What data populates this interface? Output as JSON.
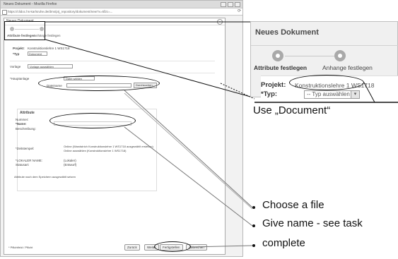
{
  "browser": {
    "title": "Neues Dokument - Mozilla Firefox",
    "url": "https://clidoc.hs-karlsruhe.de/dms/prj_repository/dokument/new?x=6f2c=..."
  },
  "dialog": {
    "header": "Neues Dokument",
    "close_glyph": "×",
    "steps": [
      "Attribute festlegen",
      "Anhänge festlegen"
    ],
    "projekt_label": "Projekt:",
    "projekt_value": "Konstruktionslehre 1 WS1718",
    "typ_label": "*Typ",
    "typ_value": "Dokument",
    "vorlage_label": "Vorlage",
    "vorlage_value": "Vorlage auswählen",
    "hauptanlage_label": "*Hauptanlage",
    "hauptanlage_value": "Datei wählen",
    "dateiname_label": "Dateiname",
    "durchsuchen_label": "Durchsuchen...",
    "section_title": "Attribute",
    "nummer_label": "Nummer:",
    "name_label": "*Name:",
    "beschreibung_label": "Beschreibung:",
    "zeitstempel_label": "*Zeitstempel:",
    "zeit_opt1": "Online (Wandstrich Konstruktionslehre 1 WS1718 ausgewählt erstellen)",
    "zeit_opt2": "Online auswählen (Konstruktionslehre 1 WS1718)",
    "lokal_label": "*LOKALER NAME:",
    "lokal_value": "(Lokaler)",
    "status_label": "Statusart:",
    "status_value": "(Entwurf)",
    "checkbox_label": "Attribute nach dem Speichern ausgewählt setzen",
    "footer_left": "* Pflichtfeld / Pflicht",
    "btn_back": "Zurück",
    "btn_next": "Weiter",
    "btn_finish": "Fertigstellen",
    "btn_cancel": "Abbrechen"
  },
  "zoom": {
    "title": "Neues Dokument",
    "step1": "Attribute festlegen",
    "step2": "Anhange festlegen",
    "projekt_label": "Projekt:",
    "projekt_value": "Konstruktionslehre 1 WS1718",
    "typ_label": "*Typ:",
    "typ_value": "-- Typ auswählen --",
    "arrow_glyph": "▾"
  },
  "callouts": {
    "use_document": "Use „Document“",
    "choose_file": "Choose a file",
    "give_name": "Give name - see task",
    "complete": "complete"
  },
  "colors": {
    "annotation": "#111111",
    "panel_bg": "#f0f0f0",
    "step_dot": "#a9a9a9"
  }
}
